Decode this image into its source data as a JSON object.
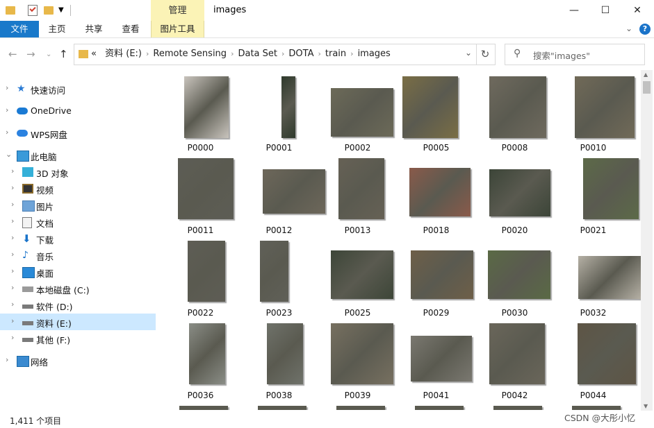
{
  "window": {
    "title": "images",
    "context_tab": "管理",
    "controls": {
      "minimize": "—",
      "maximize": "☐",
      "close": "✕"
    }
  },
  "ribbon": {
    "tabs": [
      "文件",
      "主页",
      "共享",
      "查看",
      "图片工具"
    ],
    "help": "?"
  },
  "address": {
    "prefix": "«",
    "crumbs": [
      "资料 (E:)",
      "Remote Sensing",
      "Data Set",
      "DOTA",
      "train",
      "images"
    ],
    "separator": "›"
  },
  "search": {
    "placeholder": "搜索\"images\""
  },
  "sidebar": {
    "items": [
      {
        "label": "快速访问",
        "icon": "star-icon"
      },
      {
        "label": "OneDrive",
        "icon": "cloud-icon"
      },
      {
        "label": "WPS网盘",
        "icon": "wps-cloud-icon"
      },
      {
        "label": "此电脑",
        "icon": "computer-icon"
      },
      {
        "label": "3D 对象",
        "icon": "cube-icon"
      },
      {
        "label": "视频",
        "icon": "video-icon"
      },
      {
        "label": "图片",
        "icon": "picture-icon"
      },
      {
        "label": "文档",
        "icon": "document-icon"
      },
      {
        "label": "下载",
        "icon": "download-icon"
      },
      {
        "label": "音乐",
        "icon": "music-icon"
      },
      {
        "label": "桌面",
        "icon": "desktop-icon"
      },
      {
        "label": "本地磁盘 (C:)",
        "icon": "windows-drive-icon"
      },
      {
        "label": "软件 (D:)",
        "icon": "drive-icon"
      },
      {
        "label": "资料 (E:)",
        "icon": "drive-icon",
        "selected": true
      },
      {
        "label": "其他 (F:)",
        "icon": "drive-icon"
      },
      {
        "label": "网络",
        "icon": "network-icon"
      }
    ]
  },
  "files": [
    {
      "name": "P0000",
      "color": "#c9c4bd"
    },
    {
      "name": "P0001",
      "color": "#2f3a2c"
    },
    {
      "name": "P0002",
      "color": "#6c6a58"
    },
    {
      "name": "P0005",
      "color": "#7a6e45"
    },
    {
      "name": "P0008",
      "color": "#6f6a5e"
    },
    {
      "name": "P0010",
      "color": "#716a58"
    },
    {
      "name": "P0011",
      "color": "#5d5d55"
    },
    {
      "name": "P0012",
      "color": "#6d675a"
    },
    {
      "name": "P0013",
      "color": "#666155"
    },
    {
      "name": "P0018",
      "color": "#8a5a4a"
    },
    {
      "name": "P0020",
      "color": "#3c4538"
    },
    {
      "name": "P0021",
      "color": "#5c6a48"
    },
    {
      "name": "P0022",
      "color": "#5e5d55"
    },
    {
      "name": "P0023",
      "color": "#606058"
    },
    {
      "name": "P0025",
      "color": "#3d4638"
    },
    {
      "name": "P0029",
      "color": "#6e5f48"
    },
    {
      "name": "P0030",
      "color": "#5a6a45"
    },
    {
      "name": "P0032",
      "color": "#b5b0a5"
    },
    {
      "name": "P0036",
      "color": "#8a8d86"
    },
    {
      "name": "P0038",
      "color": "#6f726a"
    },
    {
      "name": "P0039",
      "color": "#777060"
    },
    {
      "name": "P0041",
      "color": "#7a7870"
    },
    {
      "name": "P0042",
      "color": "#6a665a"
    },
    {
      "name": "P0044",
      "color": "#5e5545"
    }
  ],
  "status": {
    "count": "1,411 个项目"
  },
  "watermark": "CSDN @大彤小忆"
}
